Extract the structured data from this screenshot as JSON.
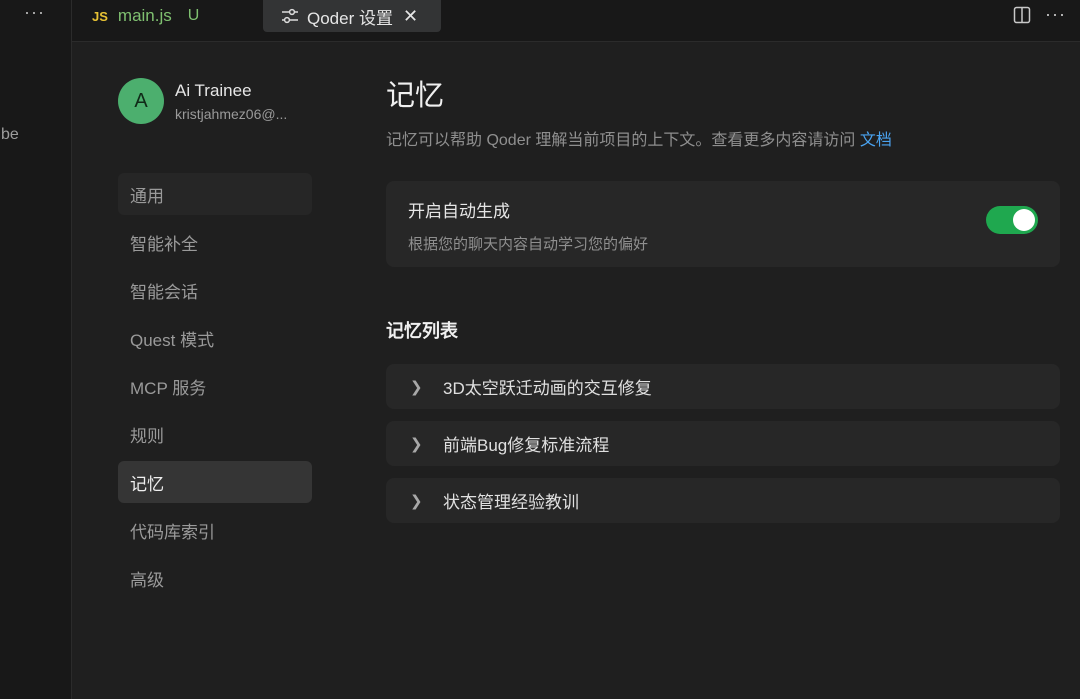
{
  "left_strip": {
    "more": "···",
    "fragment_text": "be"
  },
  "tabs": {
    "main": {
      "badge": "JS",
      "name": "main.js",
      "status": "U"
    },
    "settings": {
      "name": "Qoder 设置",
      "close": "✕"
    },
    "actions_more": "···"
  },
  "profile": {
    "initial": "A",
    "name": "Ai Trainee",
    "email": "kristjahmez06@..."
  },
  "nav": [
    {
      "label": "通用"
    },
    {
      "label": "智能补全"
    },
    {
      "label": "智能会话"
    },
    {
      "label": "Quest 模式"
    },
    {
      "label": "MCP 服务"
    },
    {
      "label": "规则"
    },
    {
      "label": "记忆"
    },
    {
      "label": "代码库索引"
    },
    {
      "label": "高级"
    }
  ],
  "main": {
    "title": "记忆",
    "description": "记忆可以帮助 Qoder 理解当前项目的上下文。查看更多内容请访问 ",
    "doc_link": "文档",
    "auto_generate": {
      "title": "开启自动生成",
      "subtitle": "根据您的聊天内容自动学习您的偏好",
      "enabled": true
    },
    "list_title": "记忆列表",
    "memories": [
      {
        "label": "3D太空跃迁动画的交互修复"
      },
      {
        "label": "前端Bug修复标准流程"
      },
      {
        "label": "状态管理经验教训"
      }
    ]
  },
  "colors": {
    "background": "#1f1f1f",
    "accent_green": "#1fa84f",
    "link_blue": "#4aa3f0",
    "avatar_green": "#4caf6e"
  }
}
